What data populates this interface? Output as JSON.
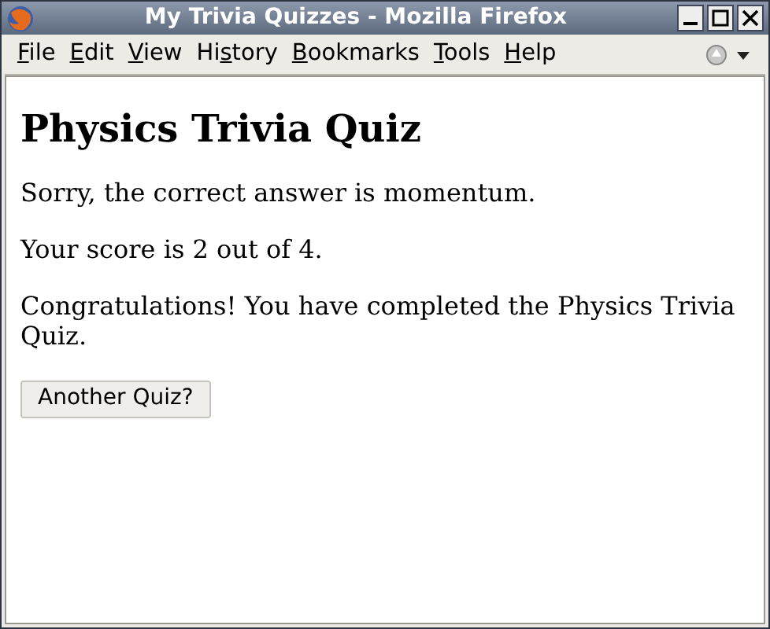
{
  "window": {
    "title": "My Trivia Quizzes - Mozilla Firefox"
  },
  "menu": [
    {
      "key": "F",
      "after": "ile"
    },
    {
      "key": "E",
      "after": "dit"
    },
    {
      "key": "V",
      "after": "iew"
    },
    {
      "before": "Hi",
      "key": "s",
      "after": "tory"
    },
    {
      "key": "B",
      "after": "ookmarks"
    },
    {
      "key": "T",
      "after": "ools"
    },
    {
      "key": "H",
      "after": "elp"
    }
  ],
  "page": {
    "heading": "Physics Trivia Quiz",
    "paragraphs": [
      "Sorry, the correct answer is momentum.",
      "Your score is 2 out of 4.",
      "Congratulations! You have completed the Physics Trivia Quiz."
    ],
    "button": "Another Quiz?"
  }
}
